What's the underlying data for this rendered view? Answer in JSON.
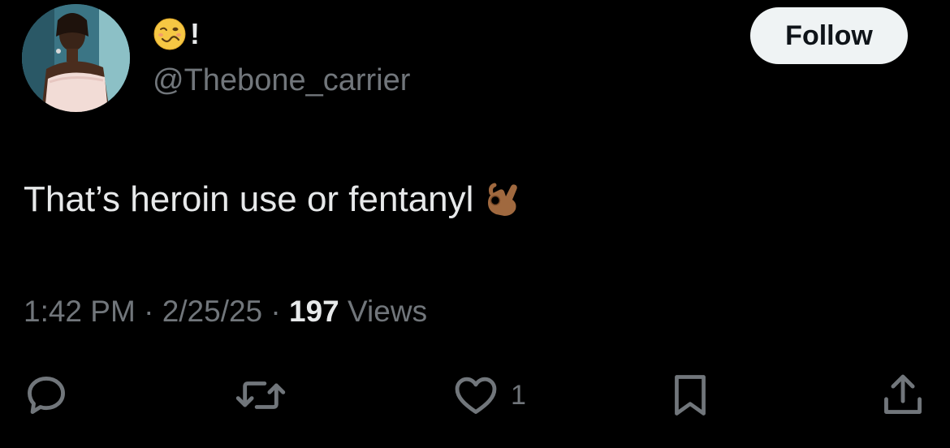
{
  "author": {
    "display_name_emoji": "woozy-face",
    "display_name_suffix": "!",
    "handle": "@Thebone_carrier",
    "avatar_icon": "profile-photo"
  },
  "follow_button": {
    "label": "Follow"
  },
  "tweet": {
    "text": "That’s heroin use or fentanyl",
    "trailing_emoji": "ok-hand-medium-dark-skin"
  },
  "meta": {
    "time": "1:42 PM",
    "separator": "·",
    "date": "2/25/25",
    "views_count": "197",
    "views_label": "Views"
  },
  "actions": {
    "reply_icon": "reply-icon",
    "retweet_icon": "retweet-icon",
    "like_icon": "heart-icon",
    "like_count": "1",
    "bookmark_icon": "bookmark-icon",
    "share_icon": "share-icon"
  },
  "colors": {
    "background": "#000000",
    "primary_text": "#e7e9ea",
    "secondary_text": "#71767b",
    "button_bg": "#eff3f4"
  }
}
